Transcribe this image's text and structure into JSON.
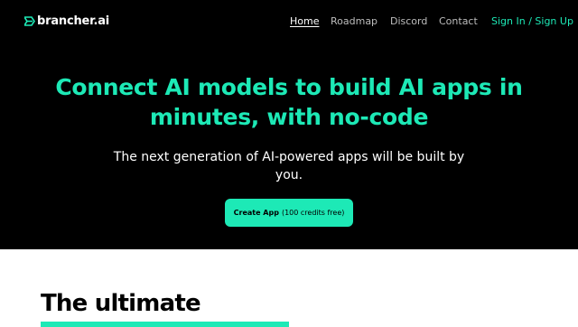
{
  "brand": {
    "name": "brancher.ai",
    "logo_icon": "lightning-icon",
    "accent_color": "#1de9b6"
  },
  "nav": {
    "home": "Home",
    "roadmap": "Roadmap",
    "discord": "Discord",
    "contact": "Contact",
    "signin": "Sign In / Sign Up"
  },
  "hero": {
    "headline": "Connect AI models to build AI apps in minutes, with no-code",
    "subheadline": "The next generation of AI-powered apps will be built by you.",
    "cta_label": "Create App",
    "cta_note": "(100 credits free)"
  },
  "section": {
    "title": "The ultimate"
  }
}
